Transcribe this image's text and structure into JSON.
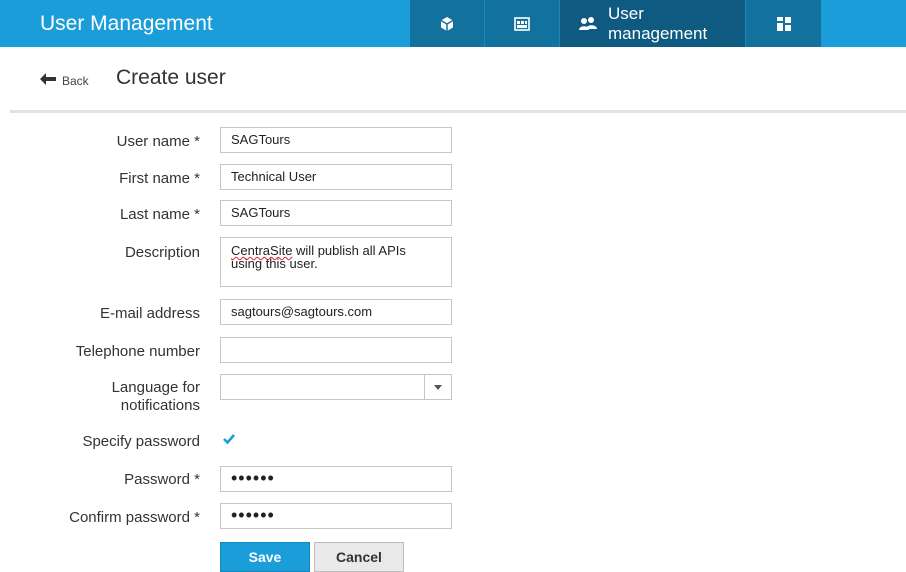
{
  "app": {
    "title": "User Management"
  },
  "nav": {
    "items": [
      {
        "icon": "cube-icon"
      },
      {
        "icon": "dashboard-icon"
      },
      {
        "icon": "users-icon",
        "label": "User management"
      },
      {
        "icon": "grid-icon"
      }
    ]
  },
  "header": {
    "back_label": "Back",
    "title": "Create user"
  },
  "form": {
    "user_name": {
      "label": "User name *",
      "value": "SAGTours"
    },
    "first_name": {
      "label": "First name *",
      "value": "Technical User"
    },
    "last_name": {
      "label": "Last name *",
      "value": "SAGTours"
    },
    "description": {
      "label": "Description",
      "value_word1": "CentraSite",
      "value_rest": " will publish all APIs\nusing this user."
    },
    "email": {
      "label": "E-mail address",
      "value": "sagtours@sagtours.com"
    },
    "telephone": {
      "label": "Telephone number",
      "value": ""
    },
    "language": {
      "label_line1": "Language for",
      "label_line2": "notifications",
      "value": ""
    },
    "specify_password": {
      "label": "Specify password",
      "checked": true
    },
    "password": {
      "label": "Password *",
      "value": "••••••"
    },
    "confirm_password": {
      "label": "Confirm password *",
      "value": "••••••"
    }
  },
  "buttons": {
    "save": "Save",
    "cancel": "Cancel"
  },
  "colors": {
    "accent": "#1b9dd9",
    "nav_dark": "#13719e",
    "nav_active": "#0e5a80"
  }
}
